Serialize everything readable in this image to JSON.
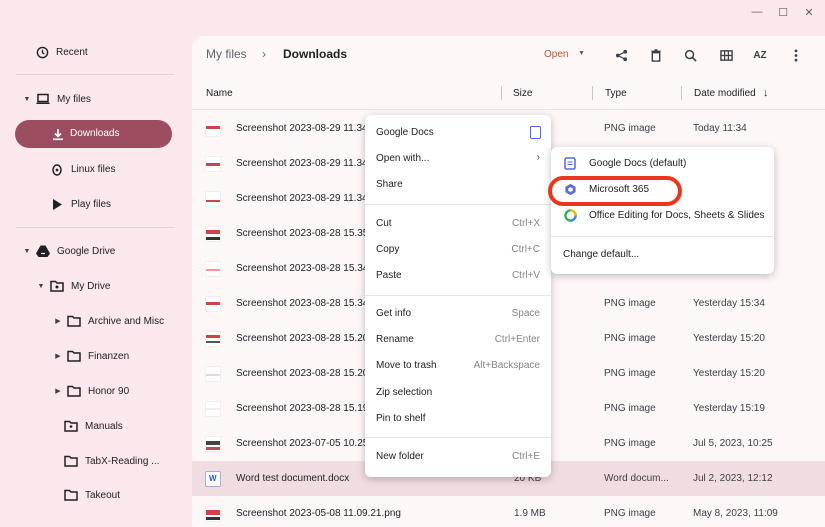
{
  "window": {
    "minimize": "—",
    "maximize": "☐",
    "close": "✕"
  },
  "sidebar": {
    "recent": "Recent",
    "my_files": "My files",
    "downloads": "Downloads",
    "linux_files": "Linux files",
    "play_files": "Play files",
    "google_drive": "Google Drive",
    "my_drive": "My Drive",
    "folders": [
      "Archive and Misc",
      "Finanzen",
      "Honor 90",
      "Manuals",
      "TabX-Reading ...",
      "Takeout"
    ]
  },
  "toolbar": {
    "crumb_root": "My files",
    "crumb_sep": "›",
    "crumb_current": "Downloads",
    "open_label": "Open",
    "sort_label": "AZ"
  },
  "columns": {
    "name": "Name",
    "size": "Size",
    "type": "Type",
    "date": "Date modified"
  },
  "files": [
    {
      "name": "Screenshot 2023-08-29 11.34...",
      "size": "",
      "type": "PNG image",
      "date": "Today 11:34"
    },
    {
      "name": "Screenshot 2023-08-29 11.34...",
      "size": "",
      "type": "",
      "date": ""
    },
    {
      "name": "Screenshot 2023-08-29 11.34...",
      "size": "",
      "type": "",
      "date": ""
    },
    {
      "name": "Screenshot 2023-08-28 15.35...",
      "size": "",
      "type": "",
      "date": ""
    },
    {
      "name": "Screenshot 2023-08-28 15.34...",
      "size": "",
      "type": "",
      "date": ""
    },
    {
      "name": "Screenshot 2023-08-28 15.34...",
      "size": "",
      "type": "PNG image",
      "date": "Yesterday 15:34"
    },
    {
      "name": "Screenshot 2023-08-28 15.20...",
      "size": "",
      "type": "PNG image",
      "date": "Yesterday 15:20"
    },
    {
      "name": "Screenshot 2023-08-28 15.20...",
      "size": "",
      "type": "PNG image",
      "date": "Yesterday 15:20"
    },
    {
      "name": "Screenshot 2023-08-28 15.19...",
      "size": "",
      "type": "PNG image",
      "date": "Yesterday 15:19"
    },
    {
      "name": "Screenshot 2023-07-05 10.25...",
      "size": "",
      "type": "PNG image",
      "date": "Jul 5, 2023, 10:25"
    },
    {
      "name": "Word test document.docx",
      "size": "20 KB",
      "type": "Word docum...",
      "date": "Jul 2, 2023, 12:12"
    },
    {
      "name": "Screenshot 2023-05-08 11.09.21.png",
      "size": "1.9 MB",
      "type": "PNG image",
      "date": "May 8, 2023, 11:09"
    }
  ],
  "context_menu": {
    "google_docs": "Google Docs",
    "open_with": "Open with...",
    "share": "Share",
    "cut": "Cut",
    "cut_sc": "Ctrl+X",
    "copy": "Copy",
    "copy_sc": "Ctrl+C",
    "paste": "Paste",
    "paste_sc": "Ctrl+V",
    "get_info": "Get info",
    "get_info_sc": "Space",
    "rename": "Rename",
    "rename_sc": "Ctrl+Enter",
    "trash": "Move to trash",
    "trash_sc": "Alt+Backspace",
    "zip": "Zip selection",
    "pin": "Pin to shelf",
    "new_folder": "New folder",
    "new_folder_sc": "Ctrl+E"
  },
  "submenu": {
    "google_docs_default": "Google Docs (default)",
    "microsoft_365": "Microsoft 365",
    "office_editing": "Office Editing for Docs, Sheets & Slides",
    "change_default": "Change default..."
  },
  "colors": {
    "accent": "#9c4d5f",
    "highlight_ring": "#e8371f",
    "open_text": "#b25a35"
  }
}
